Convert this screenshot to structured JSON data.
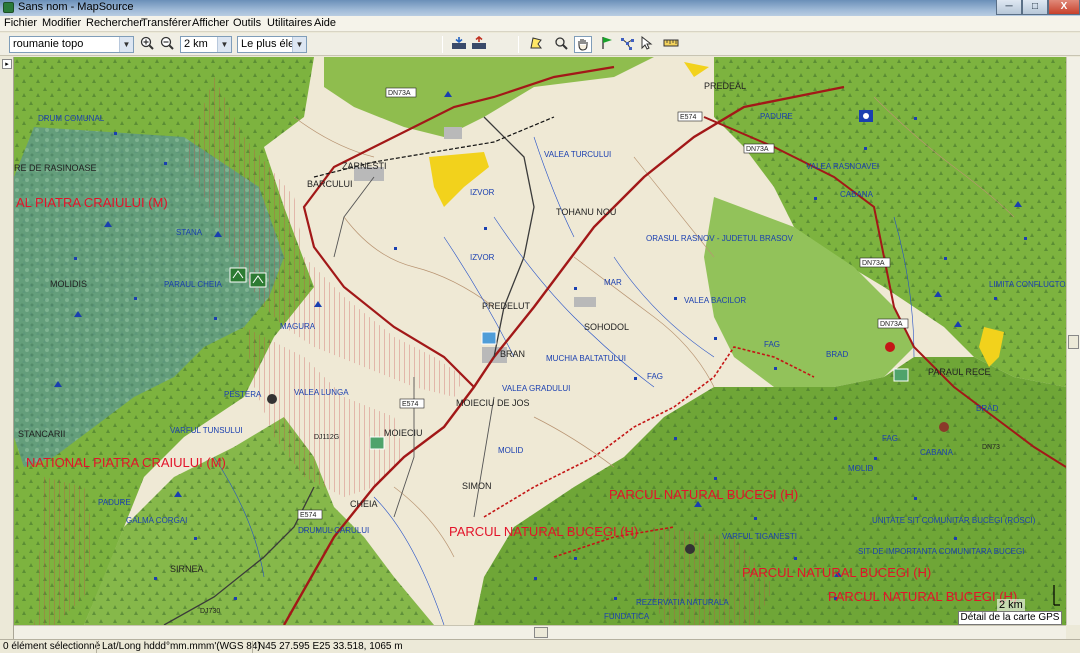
{
  "window": {
    "title": "Sans nom - MapSource"
  },
  "titlebar_buttons": {
    "minimize": "─",
    "maximize": "□",
    "close": "X"
  },
  "menu": [
    "Fichier",
    "Modifier",
    "Rechercher",
    "Transférer",
    "Afficher",
    "Outils",
    "Utilitaires",
    "Aide"
  ],
  "toolbar": {
    "map_product": "roumanie topo",
    "zoom_level": "2 km",
    "detail_level": "Le plus élevé",
    "icons": [
      "zoom-in-icon",
      "zoom-out-icon",
      "receive-from-device-icon",
      "send-to-device-icon",
      "map-tool-icon",
      "zoom-tool-icon",
      "hand-tool-icon",
      "waypoint-tool-icon",
      "route-tool-icon",
      "selection-tool-icon",
      "distance-tool-icon"
    ]
  },
  "map": {
    "area_labels": [
      "PARCUL NATURAL BUCEGI (H)",
      "PARCUL NATURAL BUCEGI (H)",
      "PARCUL NATURAL BUCEGI (H)",
      "PARCUL NATURAL BUCEGI (H)",
      "NATIONAL PIATRA CRAIULUI (M)",
      "AL PIATRA CRAIULUI (M)"
    ],
    "place_labels": [
      "ZARNESTI",
      "TOHANU NOU",
      "PREDEAL",
      "PREDELUT",
      "SOHODOL",
      "BRAN",
      "MOIECIU DE JOS",
      "MOIECIU",
      "SIMON",
      "SIRNEA",
      "CHEIA",
      "MOLIDIS",
      "STANCARII",
      "BARCULUI",
      "RE DE RASINOASE",
      "PARAUL RECE",
      "MAR",
      "FUNDATICA"
    ],
    "feature_labels": [
      "CABANA",
      "CABANA",
      "FAG",
      "FAG",
      "FAG",
      "BRAD",
      "BRAD",
      "MOLID",
      "MOLID",
      "IZVOR",
      "IZVOR",
      "PADURE",
      "PADURE",
      "MAGURA",
      "STANA",
      "DRUMUL CARULUI",
      "VALEA BACILOR",
      "VALEA RASNOAVEI",
      "VALEA LUNGA",
      "VALEA GRADULUI",
      "MUCHIA BALTATULUI",
      "ORASUL RASNOV - JUDETUL BRASOV",
      "UNITATE SIT COMUNITAR BUCEGI (ROSCI)",
      "SIT DE IMPORTANTA COMUNITARA BUCEGI",
      "REZERVATIA NATURALA",
      "DRUM COMUNAL",
      "VARFUL TUNSULUI",
      "PESTERA",
      "GALMA CORGAI",
      "LIMITA CONFLUCTOR",
      "VARFUL TIGANESTI",
      "VALEA TURCULUI",
      "PARAUL CHEIA"
    ],
    "road_labels": [
      "DN73A",
      "DN73A",
      "DN73A",
      "DN73A",
      "E574",
      "E574",
      "E574",
      "DJ112G",
      "DJ730",
      "DN73"
    ],
    "scale": "2 km",
    "detail_box": "Détail de la carte GPS"
  },
  "status": {
    "selection": "0 élément sélectionné",
    "coord_format": "Lat/Long hddd°mm.mmm'(WGS 84)",
    "position": "N45 27.595 E25 33.518, 1065 m"
  },
  "colors": {
    "park_red": "#e3132a",
    "forest_green": "#7db33f",
    "dark_forest": "#4e7f2e",
    "road_red": "#a21818",
    "label_blue": "#1a3fb0",
    "yellow_area": "#f2d21c"
  }
}
